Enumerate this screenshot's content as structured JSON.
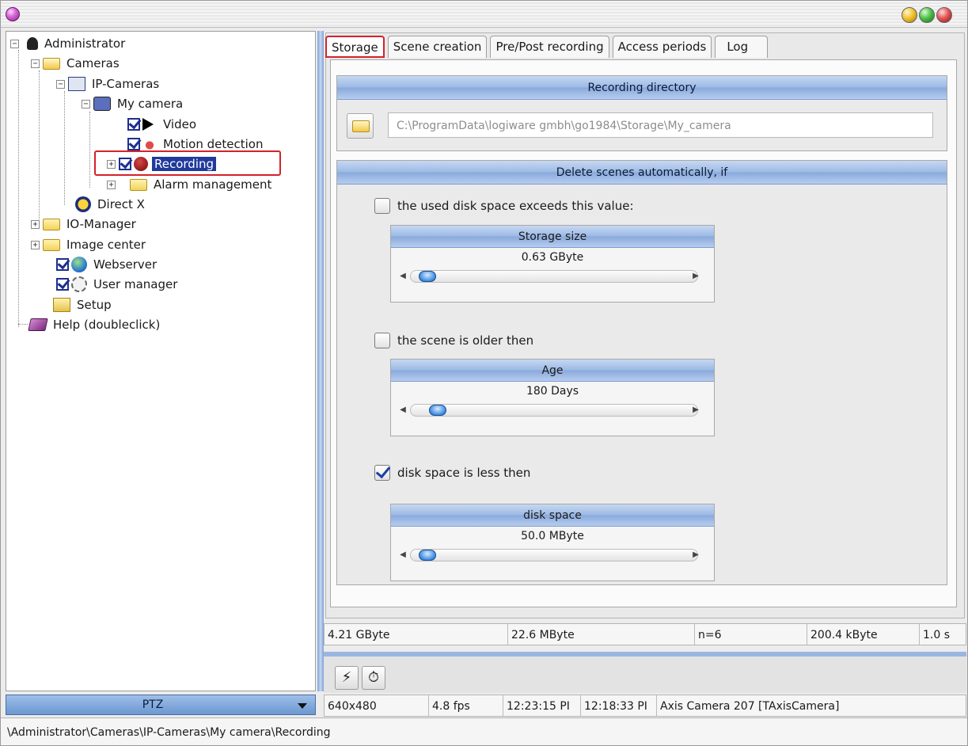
{
  "tree": {
    "items": [
      {
        "label": "Administrator"
      },
      {
        "label": "Cameras"
      },
      {
        "label": "IP-Cameras"
      },
      {
        "label": "My camera"
      },
      {
        "label": "Video"
      },
      {
        "label": "Motion detection"
      },
      {
        "label": "Recording"
      },
      {
        "label": "Alarm management"
      },
      {
        "label": "Direct X"
      },
      {
        "label": "IO-Manager"
      },
      {
        "label": "Image center"
      },
      {
        "label": "Webserver"
      },
      {
        "label": "User manager"
      },
      {
        "label": "Setup"
      },
      {
        "label": "Help (doubleclick)"
      }
    ]
  },
  "ptz": {
    "label": "PTZ"
  },
  "tabs": [
    "Storage",
    "Scene creation",
    "Pre/Post recording",
    "Access periods",
    "Log"
  ],
  "recording_directory": {
    "title": "Recording directory",
    "path": "C:\\ProgramData\\logiware gmbh\\go1984\\Storage\\My_camera"
  },
  "delete_scenes": {
    "title": "Delete scenes automatically, if",
    "options": [
      {
        "label": "the used disk space exceeds this value:",
        "checked": false,
        "slider_title": "Storage size",
        "slider_value": "0.63 GByte",
        "thumb_fraction": 0.02
      },
      {
        "label": "the scene is older then",
        "checked": false,
        "slider_title": "Age",
        "slider_value": "180 Days",
        "thumb_fraction": 0.06
      },
      {
        "label": "disk space is less then",
        "checked": true,
        "slider_title": "disk space",
        "slider_value": "50.0 MByte",
        "thumb_fraction": 0.02
      }
    ]
  },
  "storage_stats": [
    "4.21 GByte",
    "22.6 MByte",
    "n=6",
    "200.4 kByte",
    "1.0 s"
  ],
  "camera_status": [
    "640x480",
    "4.8 fps",
    "12:23:15 PI",
    "12:18:33 PI",
    "Axis Camera 207 [TAxisCamera]"
  ],
  "status_path": "\\Administrator\\Cameras\\IP-Cameras\\My camera\\Recording"
}
